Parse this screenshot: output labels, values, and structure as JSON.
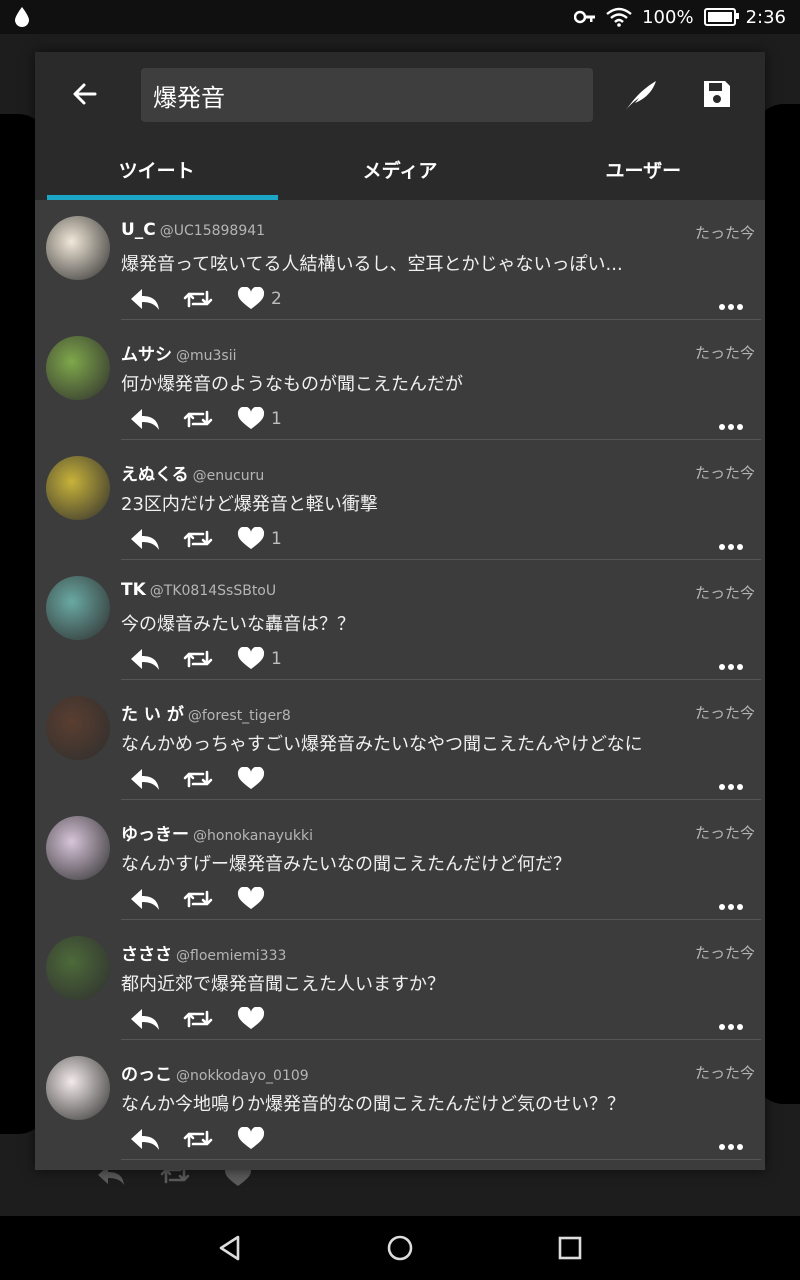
{
  "status_bar": {
    "battery": "100%",
    "time": "2:36"
  },
  "search": {
    "query": "爆発音"
  },
  "tabs": [
    {
      "label": "ツイート",
      "active": true
    },
    {
      "label": "メディア",
      "active": false
    },
    {
      "label": "ユーザー",
      "active": false
    }
  ],
  "tweets": [
    {
      "name": "U_C",
      "handle": "@UC15898941",
      "time": "たった今",
      "text": "爆発音って呟いてる人結構いるし、空耳とかじゃないっぽい...",
      "likes": "2",
      "avatar_color": "#f1e8d8"
    },
    {
      "name": "ムサシ",
      "handle": "@mu3sii",
      "time": "たった今",
      "text": "何か爆発音のようなものが聞こえたんだが",
      "likes": "1",
      "avatar_color": "#7fa84a"
    },
    {
      "name": "えぬくる",
      "handle": "@enucuru",
      "time": "たった今",
      "text": "23区内だけど爆発音と軽い衝撃",
      "likes": "1",
      "avatar_color": "#c8b33a"
    },
    {
      "name": "TK",
      "handle": "@TK0814SsSBtoU",
      "time": "たった今",
      "text": "今の爆音みたいな轟音は？？",
      "likes": "1",
      "avatar_color": "#6aa9a3"
    },
    {
      "name": "た い が",
      "handle": "@forest_tiger8",
      "time": "たった今",
      "text": "なんかめっちゃすごい爆発音みたいなやつ聞こえたんやけどなに",
      "likes": "",
      "avatar_color": "#5a3e30"
    },
    {
      "name": "ゆっきー",
      "handle": "@honokanayukki",
      "time": "たった今",
      "text": "なんかすげー爆発音みたいなの聞こえたんだけど何だ？",
      "likes": "",
      "avatar_color": "#d7c4d9"
    },
    {
      "name": "さささ",
      "handle": "@floemiemi333",
      "time": "たった今",
      "text": "都内近郊で爆発音聞こえた人いますか？",
      "likes": "",
      "avatar_color": "#4d6a3a"
    },
    {
      "name": "のっこ",
      "handle": "@nokkodayo_0109",
      "time": "たった今",
      "text": "なんか今地鳴りか爆発音的なの聞こえたんだけど気のせい？？",
      "likes": "",
      "avatar_color": "#f3eaea"
    }
  ]
}
